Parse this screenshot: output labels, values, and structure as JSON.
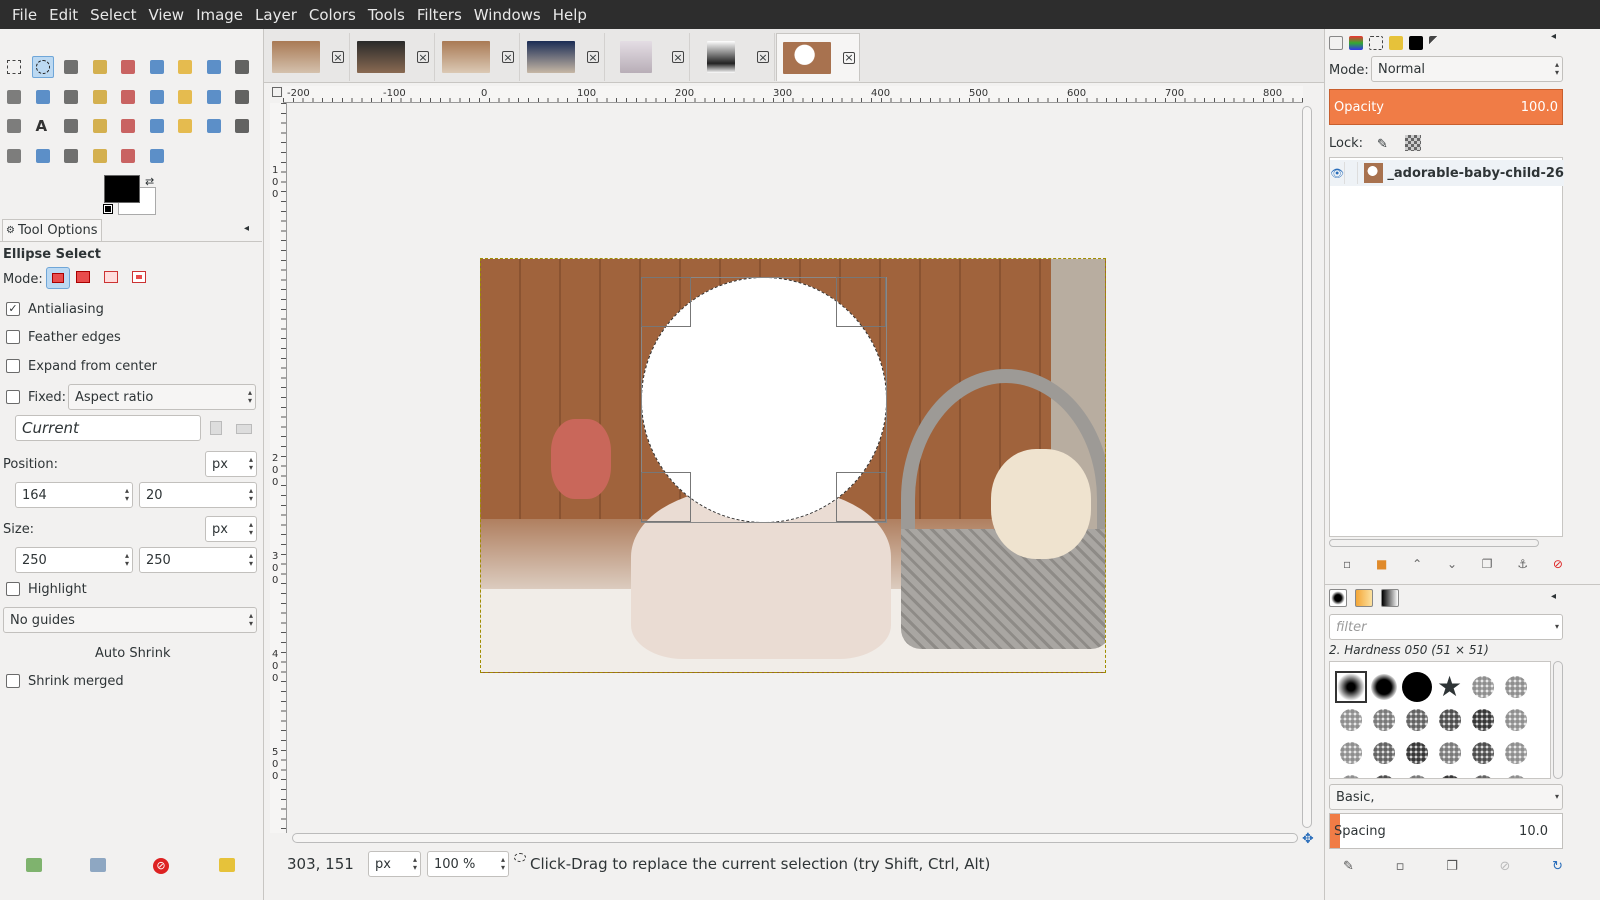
{
  "menu": [
    "File",
    "Edit",
    "Select",
    "View",
    "Image",
    "Layer",
    "Colors",
    "Tools",
    "Filters",
    "Windows",
    "Help"
  ],
  "colors": {
    "accent": "#f07c46",
    "selection": "#bcd9f2",
    "fg": "#000000",
    "bg": "#ffffff"
  },
  "toolbox": {
    "tools": [
      "rect-select",
      "ellipse-select",
      "free-select",
      "fuzzy-select",
      "by-color-select",
      "scissors",
      "foreground-select",
      "paths",
      "color-picker",
      "zoom",
      "measure",
      "move",
      "align",
      "crop",
      "unified-transform",
      "warp-transform",
      "perspective",
      "flip",
      "cage-transform",
      "text",
      "heal",
      "gradient",
      "paintbrush",
      "ink",
      "rectangle-fill",
      "smudge",
      "clone",
      "perspective-clone",
      "mypaint",
      "blur-sharpen",
      "dodge-burn",
      "smudge-tool",
      "eraser"
    ]
  },
  "tool_options": {
    "tab_label": "Tool Options",
    "tool_name": "Ellipse Select",
    "mode_label": "Mode:",
    "antialiasing": "Antialiasing",
    "feather": "Feather edges",
    "expand": "Expand from center",
    "fixed_label": "Fixed:",
    "fixed_value": "Aspect ratio",
    "current": "Current",
    "position_label": "Position:",
    "unit": "px",
    "pos_x": "164",
    "pos_y": "20",
    "size_label": "Size:",
    "size_w": "250",
    "size_h": "250",
    "highlight": "Highlight",
    "guides": "No guides",
    "auto_shrink": "Auto Shrink",
    "shrink_merged": "Shrink merged"
  },
  "ruler": {
    "h": [
      "-200",
      "-100",
      "0",
      "100",
      "200",
      "300",
      "400",
      "500",
      "600",
      "700",
      "800"
    ],
    "v": [
      "1",
      "0",
      "0",
      "2",
      "0",
      "0",
      "3",
      "0",
      "0",
      "4",
      "0",
      "0",
      "5",
      "0",
      "0"
    ]
  },
  "status": {
    "coords": "303, 151",
    "unit": "px",
    "zoom": "100 %",
    "message": "Click-Drag to replace the current selection (try Shift, Ctrl, Alt)"
  },
  "layers": {
    "mode_label": "Mode:",
    "mode_value": "Normal",
    "opacity_label": "Opacity",
    "opacity_value": "100.0",
    "lock_label": "Lock:",
    "layer_name": "_adorable-baby-child-26"
  },
  "brushes": {
    "filter_placeholder": "filter",
    "brush_name": "2. Hardness 050 (51 × 51)",
    "preset": "Basic,",
    "spacing_label": "Spacing",
    "spacing_value": "10.0"
  }
}
